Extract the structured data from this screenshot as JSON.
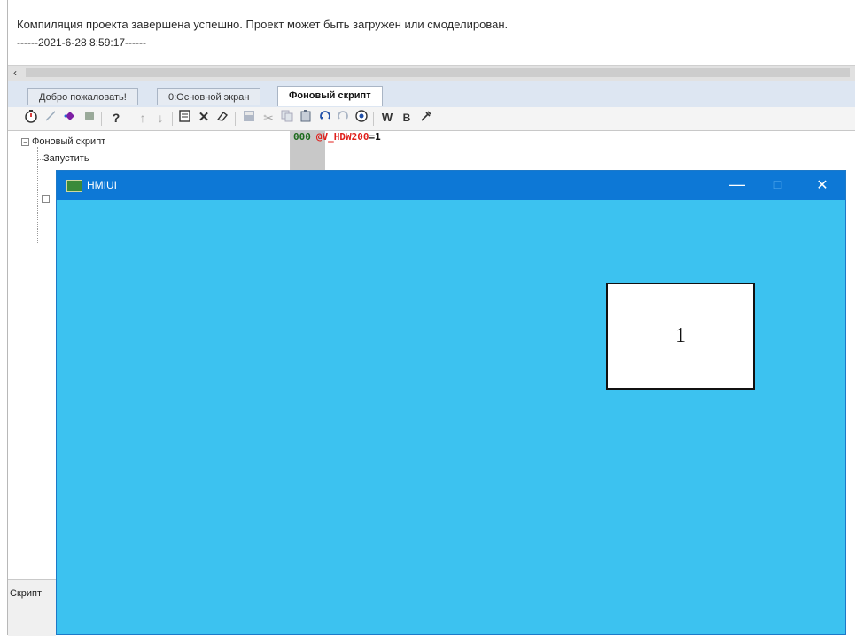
{
  "log": {
    "message": "Компиляция проекта завершена успешно. Проект может быть загружен или смоделирован.",
    "timestamp": "------2021-6-28 8:59:17------"
  },
  "scrollbar": {
    "left_arrow": "‹"
  },
  "tabs": [
    {
      "label": "Добро пожаловать!",
      "active": false
    },
    {
      "label": "0:Основной экран",
      "active": false
    },
    {
      "label": "Фоновый скрипт",
      "active": true
    }
  ],
  "toolbar": {
    "help": "?",
    "arrow_up": "↑",
    "arrow_down": "↓",
    "delete": "✕",
    "erase": "⌀",
    "word": "W",
    "bold": "B",
    "cut": "✂"
  },
  "tree": {
    "root_label": "Фоновый скрипт",
    "root_expander": "−",
    "child_label": "Запустить"
  },
  "editor": {
    "line_number": "000",
    "variable": "@V_HDW200",
    "expression": "=1"
  },
  "bottom_panel": {
    "label": "Скрипт"
  },
  "hmi_window": {
    "title": "HMIUI",
    "minimize": "—",
    "maximize": "☐",
    "close": "✕",
    "display_value": "1",
    "background_color": "#3cc2f0",
    "titlebar_color": "#0d78d6"
  }
}
